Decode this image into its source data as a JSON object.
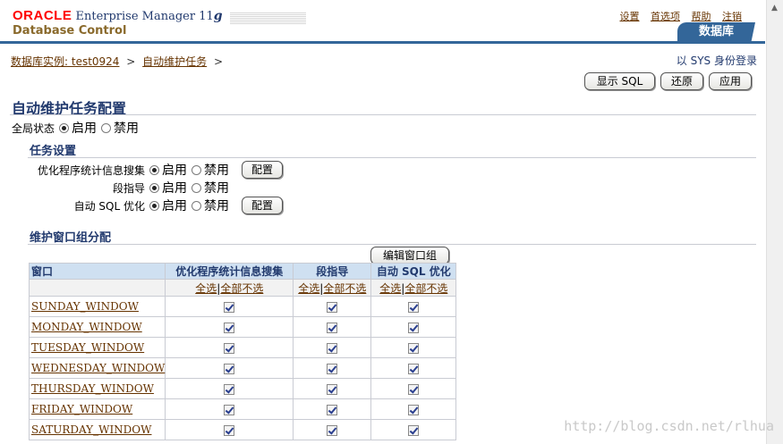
{
  "header": {
    "oracle": "ORACLE",
    "product": "Enterprise Manager 11",
    "product_suffix": "g",
    "subproduct": "Database Control",
    "links": [
      "设置",
      "首选项",
      "帮助",
      "注销"
    ],
    "tab": "数据库"
  },
  "breadcrumb": {
    "items": [
      "数据库实例: test0924",
      "自动维护任务"
    ],
    "sep": ">"
  },
  "login_info": "以 SYS 身份登录",
  "buttons": {
    "show_sql": "显示 SQL",
    "revert": "还原",
    "apply": "应用",
    "configure": "配置",
    "edit_window_group": "编辑窗口组"
  },
  "page_title": "自动维护任务配置",
  "global_status": {
    "label": "全局状态",
    "enable": "启用",
    "disable": "禁用",
    "selected": "enable"
  },
  "task_settings": {
    "title": "任务设置",
    "rows": [
      {
        "label": "优化程序统计信息搜集",
        "enable": "启用",
        "disable": "禁用",
        "selected": "enable",
        "has_config": true
      },
      {
        "label": "段指导",
        "enable": "启用",
        "disable": "禁用",
        "selected": "enable",
        "has_config": false
      },
      {
        "label": "自动 SQL 优化",
        "enable": "启用",
        "disable": "禁用",
        "selected": "enable",
        "has_config": true
      }
    ]
  },
  "window_group": {
    "title": "维护窗口组分配",
    "columns": [
      "窗口",
      "优化程序统计信息搜集",
      "段指导",
      "自动 SQL 优化"
    ],
    "select_all": "全选",
    "select_none": "全部不选",
    "rows": [
      {
        "name": "SUNDAY_WINDOW",
        "checks": [
          true,
          true,
          true
        ]
      },
      {
        "name": "MONDAY_WINDOW",
        "checks": [
          true,
          true,
          true
        ]
      },
      {
        "name": "TUESDAY_WINDOW",
        "checks": [
          true,
          true,
          true
        ]
      },
      {
        "name": "WEDNESDAY_WINDOW",
        "checks": [
          true,
          true,
          true
        ]
      },
      {
        "name": "THURSDAY_WINDOW",
        "checks": [
          true,
          true,
          true
        ]
      },
      {
        "name": "FRIDAY_WINDOW",
        "checks": [
          true,
          true,
          true
        ]
      },
      {
        "name": "SATURDAY_WINDOW",
        "checks": [
          true,
          true,
          true
        ]
      }
    ]
  },
  "watermark": "http://blog.csdn.net/rlhua"
}
